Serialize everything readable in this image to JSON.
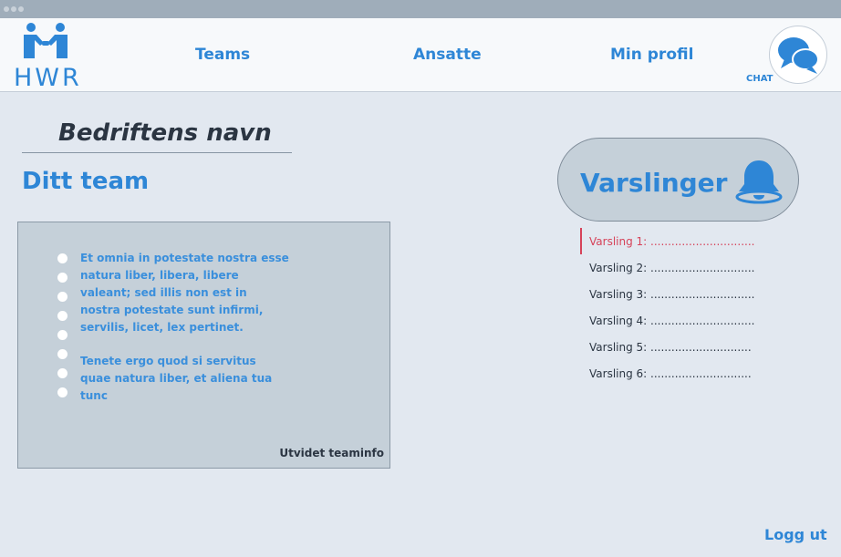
{
  "logo": {
    "text": "HWR",
    "icon": "handshake-people-icon"
  },
  "nav": {
    "teams": "Teams",
    "employees": "Ansatte",
    "profile": "Min profil"
  },
  "chat": {
    "label": "CHAT",
    "icon": "chat-bubbles-icon"
  },
  "company": {
    "name": "Bedriftens navn"
  },
  "team": {
    "heading": "Ditt team",
    "paragraphs": [
      "Et omnia in potestate nostra esse natura liber, libera, libere valeant; sed illis non est in nostra potestate sunt infirmi, servilis, licet, lex pertinet.",
      "Tenete ergo quod si servitus quae natura liber, et aliena tua tunc"
    ],
    "more_label": "Utvidet teaminfo"
  },
  "notifications": {
    "title": "Varslinger",
    "icon": "bell-icon",
    "items": [
      "Varsling 1: ..............................",
      "Varsling 2: ..............................",
      "Varsling 3: ..............................",
      "Varsling 4: ..............................",
      "Varsling 5: .............................",
      "Varsling 6: ............................."
    ]
  },
  "logout": {
    "label": "Logg ut"
  },
  "colors": {
    "accent": "#2e86d6",
    "alert": "#d6435a",
    "background": "#e2e8f0",
    "panel": "#c5d0d9"
  }
}
